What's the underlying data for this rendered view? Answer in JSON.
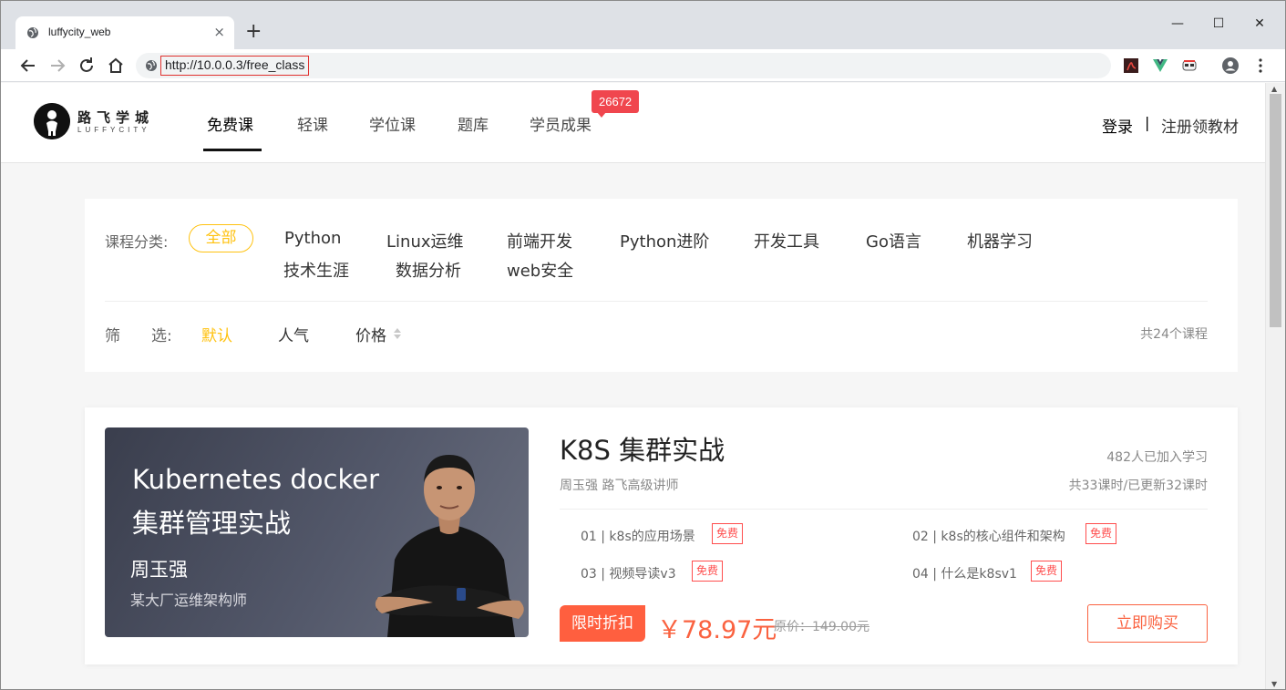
{
  "browser": {
    "tab_title": "luffycity_web",
    "tab_close": "×",
    "new_tab": "+",
    "url": "http://10.0.0.3/free_class",
    "window_controls": {
      "minimize": "—",
      "maximize": "☐",
      "close": "✕"
    }
  },
  "header": {
    "logo_cn": "路飞学城",
    "logo_en": "LUFFYCITY",
    "nav": [
      "免费课",
      "轻课",
      "学位课",
      "题库",
      "学员成果"
    ],
    "badge": "26672",
    "login": "登录",
    "separator": "|",
    "register": "注册领教材"
  },
  "filter": {
    "category_label": "课程分类:",
    "all": "全部",
    "categories": [
      "Python",
      "Linux运维",
      "前端开发",
      "Python进阶",
      "开发工具",
      "Go语言",
      "机器学习",
      "技术生涯",
      "数据分析",
      "web安全"
    ],
    "sort_label_1": "筛",
    "sort_label_2": "选:",
    "sort_default": "默认",
    "sort_popular": "人气",
    "sort_price": "价格",
    "total": "共24个课程"
  },
  "course": {
    "cover_line1": "Kubernetes docker",
    "cover_line2": "集群管理实战",
    "cover_name": "周玉强",
    "cover_role": "某大厂运维架构师",
    "title": "K8S 集群实战",
    "learners": "482人已加入学习",
    "teacher": "周玉强 路飞高级讲师",
    "lesson_count": "共33课时/已更新32课时",
    "lessons": [
      {
        "label": "01 | k8s的应用场景",
        "tag": "免费"
      },
      {
        "label": "02 | k8s的核心组件和架构",
        "tag": "免费"
      },
      {
        "label": "03 | 视频导读v3",
        "tag": "免费"
      },
      {
        "label": "04 | 什么是k8sv1",
        "tag": "免费"
      }
    ],
    "promo": "限时折扣",
    "price": "￥78.97元",
    "original_price": "原价：149.00元",
    "buy": "立即购买"
  },
  "colors": {
    "accent_yellow": "#ffc210",
    "price_orange": "#fa6240",
    "badge_red": "#f0464e",
    "url_highlight": "#e0312e"
  }
}
